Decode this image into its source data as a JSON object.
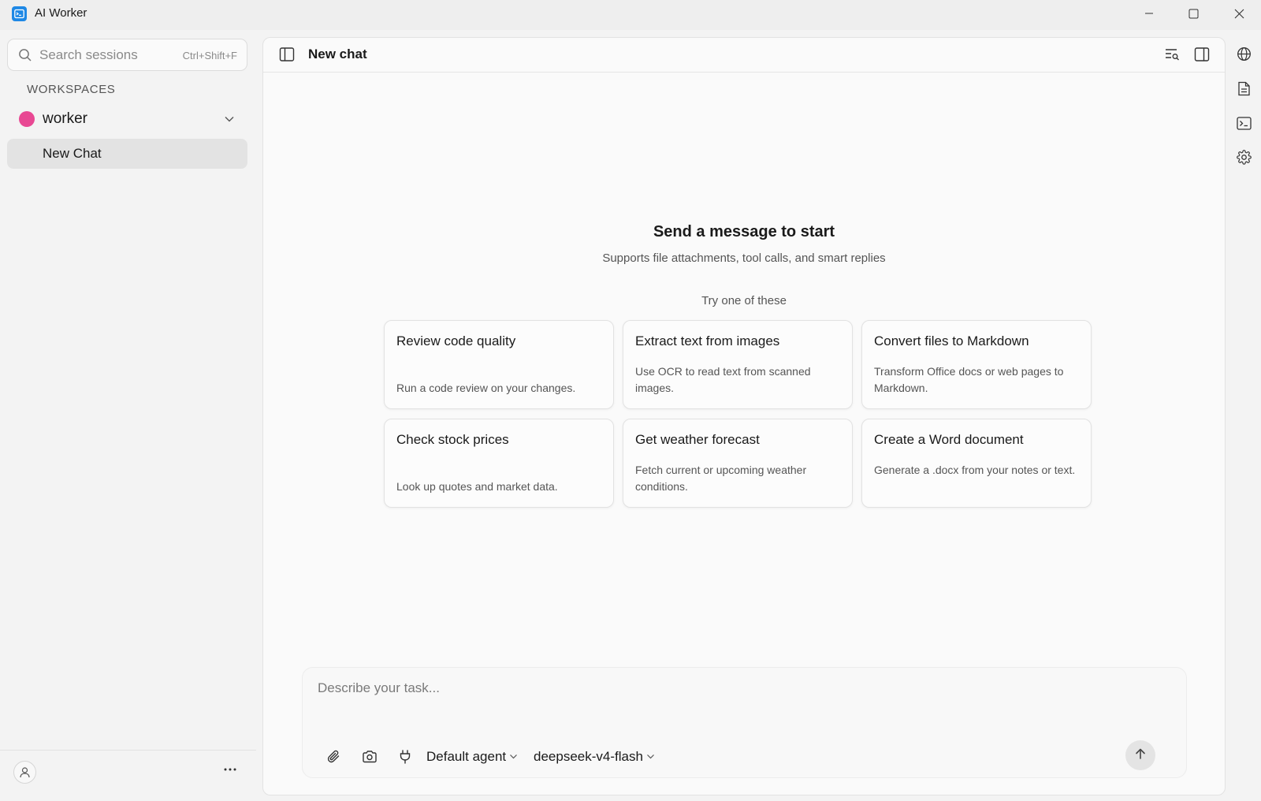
{
  "app": {
    "title": "AI Worker"
  },
  "sidebar": {
    "search": {
      "placeholder": "Search sessions",
      "shortcut": "Ctrl+Shift+F"
    },
    "workspaces_heading": "WORKSPACES",
    "workspace": {
      "name": "worker",
      "color": "#e84893"
    },
    "chats": [
      {
        "label": "New Chat",
        "active": true
      }
    ]
  },
  "main": {
    "title": "New chat",
    "hero": {
      "title": "Send a message to start",
      "subtitle": "Supports file attachments, tool calls, and smart replies"
    },
    "try_label": "Try one of these",
    "suggestions": [
      {
        "title": "Review code quality",
        "desc": "Run a code review on your changes."
      },
      {
        "title": "Extract text from images",
        "desc": "Use OCR to read text from scanned images."
      },
      {
        "title": "Convert files to Markdown",
        "desc": "Transform Office docs or web pages to Markdown."
      },
      {
        "title": "Check stock prices",
        "desc": "Look up quotes and market data."
      },
      {
        "title": "Get weather forecast",
        "desc": "Fetch current or upcoming weather conditions."
      },
      {
        "title": "Create a Word document",
        "desc": "Generate a .docx from your notes or text."
      }
    ],
    "composer": {
      "placeholder": "Describe your task...",
      "agent": "Default agent",
      "model": "deepseek-v4-flash"
    }
  },
  "icons": {
    "titlebar": [
      "app-logo-icon",
      "minimize-icon",
      "maximize-icon",
      "close-icon"
    ],
    "header": [
      "sidebar-toggle-icon",
      "search-list-icon",
      "panel-right-icon"
    ],
    "composer": [
      "paperclip-icon",
      "camera-icon",
      "plug-icon",
      "arrow-up-icon"
    ],
    "rail": [
      "globe-icon",
      "document-icon",
      "terminal-icon",
      "gear-icon"
    ],
    "footer": [
      "user-icon",
      "more-icon"
    ]
  },
  "colors": {
    "accent": "#1e88e5",
    "workspace_dot": "#e84893"
  }
}
